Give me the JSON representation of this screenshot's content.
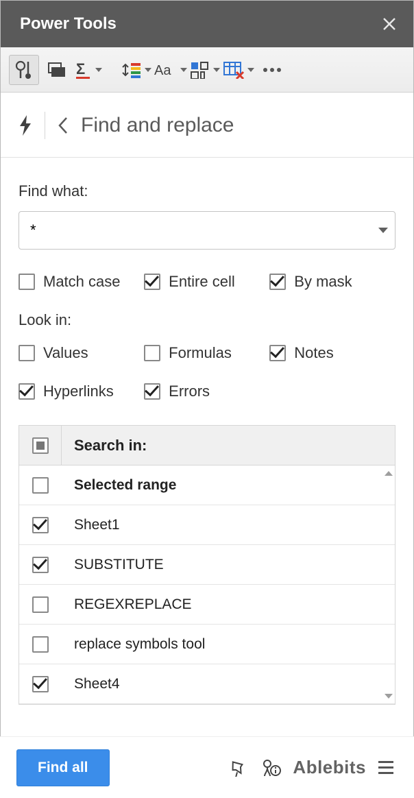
{
  "titlebar": {
    "title": "Power Tools"
  },
  "header": {
    "title": "Find and replace"
  },
  "find": {
    "label": "Find what:",
    "value": "*",
    "options": {
      "match_case": {
        "label": "Match case",
        "checked": false
      },
      "entire_cell": {
        "label": "Entire cell",
        "checked": true
      },
      "by_mask": {
        "label": "By mask",
        "checked": true
      }
    }
  },
  "look_in": {
    "label": "Look in:",
    "values_opt": {
      "label": "Values",
      "checked": false
    },
    "formulas": {
      "label": "Formulas",
      "checked": false
    },
    "notes": {
      "label": "Notes",
      "checked": true
    },
    "hyperlinks": {
      "label": "Hyperlinks",
      "checked": true
    },
    "errors": {
      "label": "Errors",
      "checked": true
    }
  },
  "search_in": {
    "header": "Search in:",
    "header_state": "indeterminate",
    "rows": [
      {
        "label": "Selected range",
        "checked": false,
        "bold": true
      },
      {
        "label": "Sheet1",
        "checked": true,
        "bold": false
      },
      {
        "label": "SUBSTITUTE",
        "checked": true,
        "bold": false
      },
      {
        "label": "REGEXREPLACE",
        "checked": false,
        "bold": false
      },
      {
        "label": "replace symbols tool",
        "checked": false,
        "bold": false
      },
      {
        "label": "Sheet4",
        "checked": true,
        "bold": false
      }
    ]
  },
  "footer": {
    "primary_button": "Find all",
    "brand": "Ablebits"
  }
}
